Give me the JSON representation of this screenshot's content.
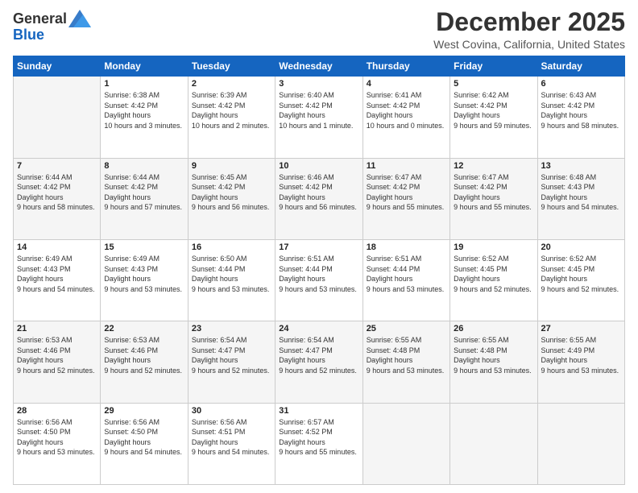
{
  "logo": {
    "line1": "General",
    "line2": "Blue"
  },
  "title": "December 2025",
  "location": "West Covina, California, United States",
  "weekdays": [
    "Sunday",
    "Monday",
    "Tuesday",
    "Wednesday",
    "Thursday",
    "Friday",
    "Saturday"
  ],
  "weeks": [
    [
      {
        "day": "",
        "sunrise": "",
        "sunset": "",
        "daylight": ""
      },
      {
        "day": "1",
        "sunrise": "Sunrise: 6:38 AM",
        "sunset": "Sunset: 4:42 PM",
        "daylight": "Daylight: 10 hours and 3 minutes."
      },
      {
        "day": "2",
        "sunrise": "Sunrise: 6:39 AM",
        "sunset": "Sunset: 4:42 PM",
        "daylight": "Daylight: 10 hours and 2 minutes."
      },
      {
        "day": "3",
        "sunrise": "Sunrise: 6:40 AM",
        "sunset": "Sunset: 4:42 PM",
        "daylight": "Daylight: 10 hours and 1 minute."
      },
      {
        "day": "4",
        "sunrise": "Sunrise: 6:41 AM",
        "sunset": "Sunset: 4:42 PM",
        "daylight": "Daylight: 10 hours and 0 minutes."
      },
      {
        "day": "5",
        "sunrise": "Sunrise: 6:42 AM",
        "sunset": "Sunset: 4:42 PM",
        "daylight": "Daylight: 9 hours and 59 minutes."
      },
      {
        "day": "6",
        "sunrise": "Sunrise: 6:43 AM",
        "sunset": "Sunset: 4:42 PM",
        "daylight": "Daylight: 9 hours and 58 minutes."
      }
    ],
    [
      {
        "day": "7",
        "sunrise": "Sunrise: 6:44 AM",
        "sunset": "Sunset: 4:42 PM",
        "daylight": "Daylight: 9 hours and 58 minutes."
      },
      {
        "day": "8",
        "sunrise": "Sunrise: 6:44 AM",
        "sunset": "Sunset: 4:42 PM",
        "daylight": "Daylight: 9 hours and 57 minutes."
      },
      {
        "day": "9",
        "sunrise": "Sunrise: 6:45 AM",
        "sunset": "Sunset: 4:42 PM",
        "daylight": "Daylight: 9 hours and 56 minutes."
      },
      {
        "day": "10",
        "sunrise": "Sunrise: 6:46 AM",
        "sunset": "Sunset: 4:42 PM",
        "daylight": "Daylight: 9 hours and 56 minutes."
      },
      {
        "day": "11",
        "sunrise": "Sunrise: 6:47 AM",
        "sunset": "Sunset: 4:42 PM",
        "daylight": "Daylight: 9 hours and 55 minutes."
      },
      {
        "day": "12",
        "sunrise": "Sunrise: 6:47 AM",
        "sunset": "Sunset: 4:42 PM",
        "daylight": "Daylight: 9 hours and 55 minutes."
      },
      {
        "day": "13",
        "sunrise": "Sunrise: 6:48 AM",
        "sunset": "Sunset: 4:43 PM",
        "daylight": "Daylight: 9 hours and 54 minutes."
      }
    ],
    [
      {
        "day": "14",
        "sunrise": "Sunrise: 6:49 AM",
        "sunset": "Sunset: 4:43 PM",
        "daylight": "Daylight: 9 hours and 54 minutes."
      },
      {
        "day": "15",
        "sunrise": "Sunrise: 6:49 AM",
        "sunset": "Sunset: 4:43 PM",
        "daylight": "Daylight: 9 hours and 53 minutes."
      },
      {
        "day": "16",
        "sunrise": "Sunrise: 6:50 AM",
        "sunset": "Sunset: 4:44 PM",
        "daylight": "Daylight: 9 hours and 53 minutes."
      },
      {
        "day": "17",
        "sunrise": "Sunrise: 6:51 AM",
        "sunset": "Sunset: 4:44 PM",
        "daylight": "Daylight: 9 hours and 53 minutes."
      },
      {
        "day": "18",
        "sunrise": "Sunrise: 6:51 AM",
        "sunset": "Sunset: 4:44 PM",
        "daylight": "Daylight: 9 hours and 53 minutes."
      },
      {
        "day": "19",
        "sunrise": "Sunrise: 6:52 AM",
        "sunset": "Sunset: 4:45 PM",
        "daylight": "Daylight: 9 hours and 52 minutes."
      },
      {
        "day": "20",
        "sunrise": "Sunrise: 6:52 AM",
        "sunset": "Sunset: 4:45 PM",
        "daylight": "Daylight: 9 hours and 52 minutes."
      }
    ],
    [
      {
        "day": "21",
        "sunrise": "Sunrise: 6:53 AM",
        "sunset": "Sunset: 4:46 PM",
        "daylight": "Daylight: 9 hours and 52 minutes."
      },
      {
        "day": "22",
        "sunrise": "Sunrise: 6:53 AM",
        "sunset": "Sunset: 4:46 PM",
        "daylight": "Daylight: 9 hours and 52 minutes."
      },
      {
        "day": "23",
        "sunrise": "Sunrise: 6:54 AM",
        "sunset": "Sunset: 4:47 PM",
        "daylight": "Daylight: 9 hours and 52 minutes."
      },
      {
        "day": "24",
        "sunrise": "Sunrise: 6:54 AM",
        "sunset": "Sunset: 4:47 PM",
        "daylight": "Daylight: 9 hours and 52 minutes."
      },
      {
        "day": "25",
        "sunrise": "Sunrise: 6:55 AM",
        "sunset": "Sunset: 4:48 PM",
        "daylight": "Daylight: 9 hours and 53 minutes."
      },
      {
        "day": "26",
        "sunrise": "Sunrise: 6:55 AM",
        "sunset": "Sunset: 4:48 PM",
        "daylight": "Daylight: 9 hours and 53 minutes."
      },
      {
        "day": "27",
        "sunrise": "Sunrise: 6:55 AM",
        "sunset": "Sunset: 4:49 PM",
        "daylight": "Daylight: 9 hours and 53 minutes."
      }
    ],
    [
      {
        "day": "28",
        "sunrise": "Sunrise: 6:56 AM",
        "sunset": "Sunset: 4:50 PM",
        "daylight": "Daylight: 9 hours and 53 minutes."
      },
      {
        "day": "29",
        "sunrise": "Sunrise: 6:56 AM",
        "sunset": "Sunset: 4:50 PM",
        "daylight": "Daylight: 9 hours and 54 minutes."
      },
      {
        "day": "30",
        "sunrise": "Sunrise: 6:56 AM",
        "sunset": "Sunset: 4:51 PM",
        "daylight": "Daylight: 9 hours and 54 minutes."
      },
      {
        "day": "31",
        "sunrise": "Sunrise: 6:57 AM",
        "sunset": "Sunset: 4:52 PM",
        "daylight": "Daylight: 9 hours and 55 minutes."
      },
      {
        "day": "",
        "sunrise": "",
        "sunset": "",
        "daylight": ""
      },
      {
        "day": "",
        "sunrise": "",
        "sunset": "",
        "daylight": ""
      },
      {
        "day": "",
        "sunrise": "",
        "sunset": "",
        "daylight": ""
      }
    ]
  ]
}
